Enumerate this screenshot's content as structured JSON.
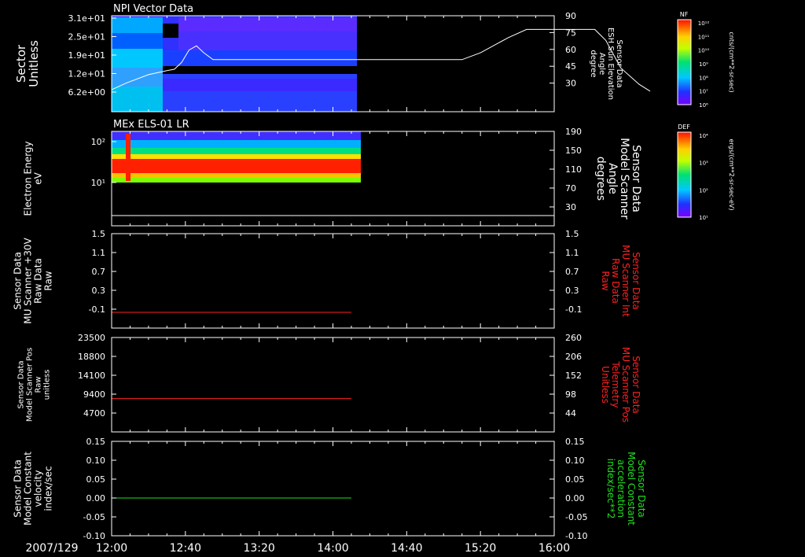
{
  "date_label": "2007/129",
  "x_ticks": [
    "12:00",
    "12:40",
    "13:20",
    "14:00",
    "14:40",
    "15:20",
    "16:00"
  ],
  "colors": {
    "bg": "#000000",
    "axis": "#ffffff",
    "red_trace": "#ff2020",
    "green_trace": "#20e020"
  },
  "panels": [
    {
      "title": "NPI Vector Data",
      "left_label": [
        "Sector",
        "Unitless"
      ],
      "left_ticks": [
        "3.1e+01",
        "2.5e+01",
        "1.9e+01",
        "1.2e+01",
        "6.2e+00"
      ],
      "right_label": [
        "Sensor Data",
        "ESH Sun Elevation",
        "Angle",
        "degree"
      ],
      "right_ticks": [
        "90",
        "75",
        "60",
        "45",
        "30"
      ]
    },
    {
      "title": "MEx ELS-01 LR",
      "left_label": [
        "Electron Energy",
        "eV"
      ],
      "left_ticks": [
        "10²",
        "10¹"
      ],
      "right_label": [
        "Sensor Data",
        "Model Scanner",
        "Angle",
        "degrees"
      ],
      "right_ticks": [
        "190",
        "150",
        "110",
        "70",
        "30"
      ]
    },
    {
      "title": "",
      "left_label": [
        "Sensor Data",
        "MU Scanner +30V",
        "Raw Data",
        "Raw"
      ],
      "left_ticks": [
        "1.5",
        "1.1",
        "0.7",
        "0.3",
        "-0.1"
      ],
      "right_label": [
        "Sensor Data",
        "MU Scanner Int",
        "Raw Data",
        "Raw"
      ],
      "right_ticks": [
        "1.5",
        "1.1",
        "0.7",
        "0.3",
        "-0.1"
      ]
    },
    {
      "title": "",
      "left_label": [
        "Sensor Data",
        "Model Scanner Pos",
        "Raw",
        "unitless"
      ],
      "left_ticks": [
        "23500",
        "18800",
        "14100",
        "9400",
        "4700"
      ],
      "right_label": [
        "Sensor Data",
        "MU Scanner Pos",
        "Telemetry",
        "Unitless"
      ],
      "right_ticks": [
        "260",
        "206",
        "152",
        "98",
        "44"
      ]
    },
    {
      "title": "",
      "left_label": [
        "Sensor Data",
        "Model Constant",
        "velocity",
        "index/sec"
      ],
      "left_ticks": [
        "0.15",
        "0.10",
        "0.05",
        "0.00",
        "-0.05",
        "-0.10"
      ],
      "right_label": [
        "Sensor Data",
        "Model Constant",
        "acceleration",
        "index/sec**2"
      ],
      "right_ticks": [
        "0.15",
        "0.10",
        "0.05",
        "0.00",
        "-0.05",
        "-0.10"
      ]
    }
  ],
  "colorbars": [
    {
      "title": "NF",
      "units": "cnts/(cm**2-sr-sec)",
      "ticks": [
        "10¹²",
        "10¹¹",
        "10¹⁰",
        "10⁹",
        "10⁸",
        "10⁷",
        "10⁶"
      ]
    },
    {
      "title": "DEF",
      "units": "ergs/(cm**2-sr-sec-eV)",
      "ticks": [
        "10⁴",
        "10³",
        "10²",
        "10¹"
      ]
    }
  ],
  "chart_data": [
    {
      "type": "heatmap",
      "title": "NPI Vector Data",
      "x_range": [
        "12:00",
        "16:00"
      ],
      "data_end": "14:07",
      "ylabel": "Sector Unitless",
      "overlay_line": {
        "ylabel": "ESH Sun Elevation Angle degree",
        "ylim": [
          20,
          90
        ],
        "x_minutes": [
          0,
          5,
          10,
          20,
          30,
          35,
          38,
          42,
          46,
          52,
          60,
          180,
          190,
          210,
          225,
          240,
          255,
          262,
          270,
          280,
          290,
          300,
          310,
          240
        ],
        "points": [
          [
            0,
            36
          ],
          [
            8,
            41
          ],
          [
            20,
            47
          ],
          [
            30,
            50
          ],
          [
            34,
            51
          ],
          [
            38,
            56
          ],
          [
            42,
            65
          ],
          [
            46,
            68
          ],
          [
            50,
            63
          ],
          [
            55,
            58
          ],
          [
            60,
            58
          ],
          [
            120,
            58
          ],
          [
            180,
            58
          ],
          [
            190,
            58
          ],
          [
            200,
            63
          ],
          [
            215,
            74
          ],
          [
            225,
            80
          ],
          [
            240,
            80
          ],
          [
            255,
            80
          ],
          [
            262,
            80
          ],
          [
            268,
            72
          ],
          [
            276,
            52
          ],
          [
            286,
            40
          ],
          [
            292,
            35
          ]
        ]
      }
    },
    {
      "type": "heatmap",
      "title": "MEx ELS-01 LR",
      "x_range": [
        "12:00",
        "16:00"
      ],
      "data_end": "14:10",
      "ylabel": "Electron Energy eV",
      "overlay_line": {
        "ylabel": "Model Scanner Angle degrees",
        "value": 10
      }
    },
    {
      "type": "line",
      "xlabel": "",
      "ylabel": "MU Scanner +30V Raw Data Raw",
      "ylim": [
        -0.3,
        1.5
      ],
      "series": [
        {
          "name": "",
          "x": [
            "12:00",
            "14:10"
          ],
          "values": [
            0,
            0
          ]
        }
      ]
    },
    {
      "type": "line",
      "xlabel": "",
      "ylabel": "Model Scanner Pos Raw unitless",
      "ylim": [
        0,
        23500
      ],
      "series": [
        {
          "name": "",
          "x": [
            "12:00",
            "14:10"
          ],
          "values": [
            8300,
            8300
          ]
        }
      ]
    },
    {
      "type": "line",
      "xlabel": "",
      "ylabel": "Model Constant velocity index/sec",
      "ylim": [
        -0.1,
        0.15
      ],
      "series": [
        {
          "name": "",
          "x": [
            "12:00",
            "14:10"
          ],
          "values": [
            0,
            0
          ]
        }
      ]
    }
  ]
}
